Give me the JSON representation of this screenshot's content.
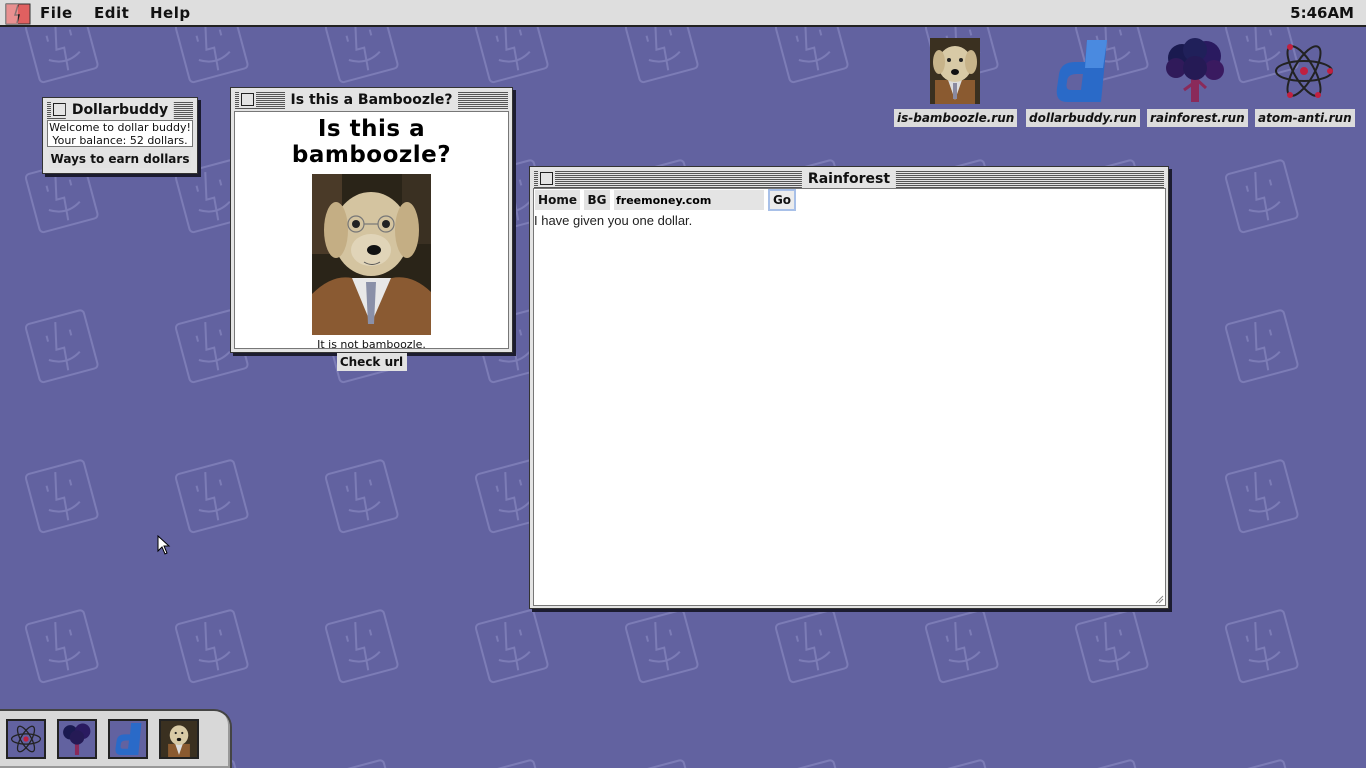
{
  "menubar": {
    "menus": [
      "File",
      "Edit",
      "Help"
    ],
    "clock": "5:46AM"
  },
  "desktop_icons": [
    {
      "label": "is-bamboozle.run",
      "icon": "dog-photo-icon"
    },
    {
      "label": "dollarbuddy.run",
      "icon": "dollarbuddy-logo-icon"
    },
    {
      "label": "rainforest.run",
      "icon": "tree-icon"
    },
    {
      "label": "atom-anti.run",
      "icon": "atom-icon"
    }
  ],
  "dollarbuddy": {
    "title": "Dollarbuddy",
    "welcome": "Welcome to dollar buddy!",
    "balance": "Your balance: 52 dollars.",
    "earn_button": "Ways to earn dollars"
  },
  "bamboozle": {
    "title": "Is this a Bamboozle?",
    "heading": "Is this a bamboozle?",
    "result": "It is not bamboozle.",
    "check_button": "Check url"
  },
  "rainforest": {
    "title": "Rainforest",
    "home_button": "Home",
    "bg_button": "BG",
    "url_value": "freemoney.com",
    "go_button": "Go",
    "body_text": "I have given you one dollar."
  },
  "dock": {
    "items": [
      "atom-icon",
      "tree-icon",
      "dollarbuddy-logo-icon",
      "dog-photo-icon"
    ]
  },
  "colors": {
    "desktop": "#6262a0",
    "window": "#e4e4e4",
    "label_bg": "#dcdcdc"
  }
}
